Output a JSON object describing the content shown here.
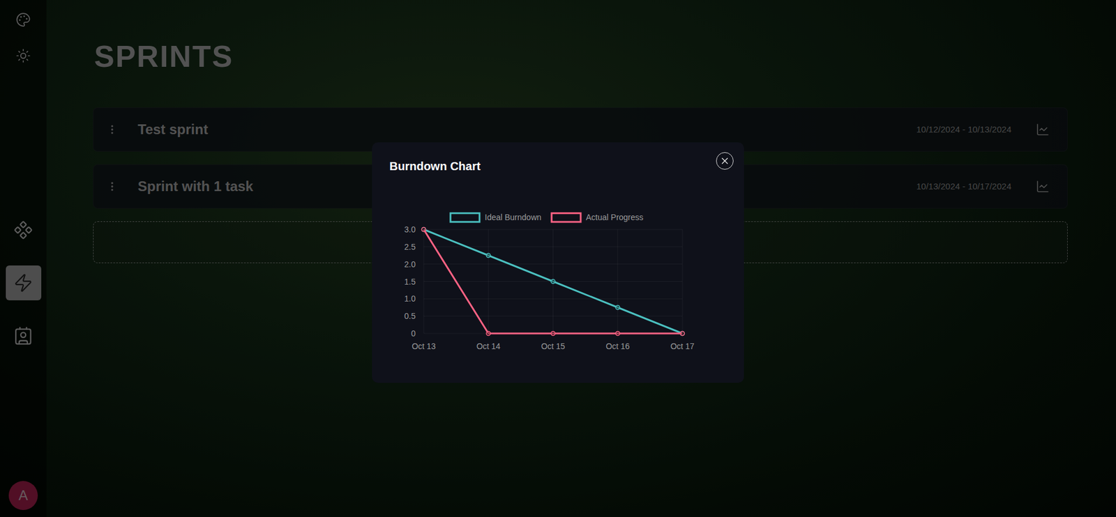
{
  "sidebar": {
    "nav": [
      {
        "selected": false
      },
      {
        "selected": true
      },
      {
        "selected": false
      }
    ],
    "avatar": {
      "initial": "A"
    }
  },
  "page": {
    "title": "SPRINTS"
  },
  "sprints": [
    {
      "name": "Test sprint",
      "dates": "10/12/2024 - 10/13/2024"
    },
    {
      "name": "Sprint with 1 task",
      "dates": "10/13/2024 - 10/17/2024"
    }
  ],
  "dialog": {
    "title": "Burndown Chart",
    "chart": {
      "y_ticks": [
        "3.0",
        "2.5",
        "2.0",
        "1.5",
        "1.0",
        "0.5",
        "0"
      ],
      "x_labels": [
        "Oct 13",
        "Oct 14",
        "Oct 15",
        "Oct 16",
        "Oct 17"
      ],
      "series": [
        {
          "label": "Ideal Burndown",
          "color": "#4bc0c0",
          "values": [
            3,
            2.25,
            1.5,
            0.75,
            0
          ]
        },
        {
          "label": "Actual Progress",
          "color": "#ff6384",
          "values": [
            3,
            0,
            0,
            0,
            0
          ]
        }
      ]
    }
  }
}
